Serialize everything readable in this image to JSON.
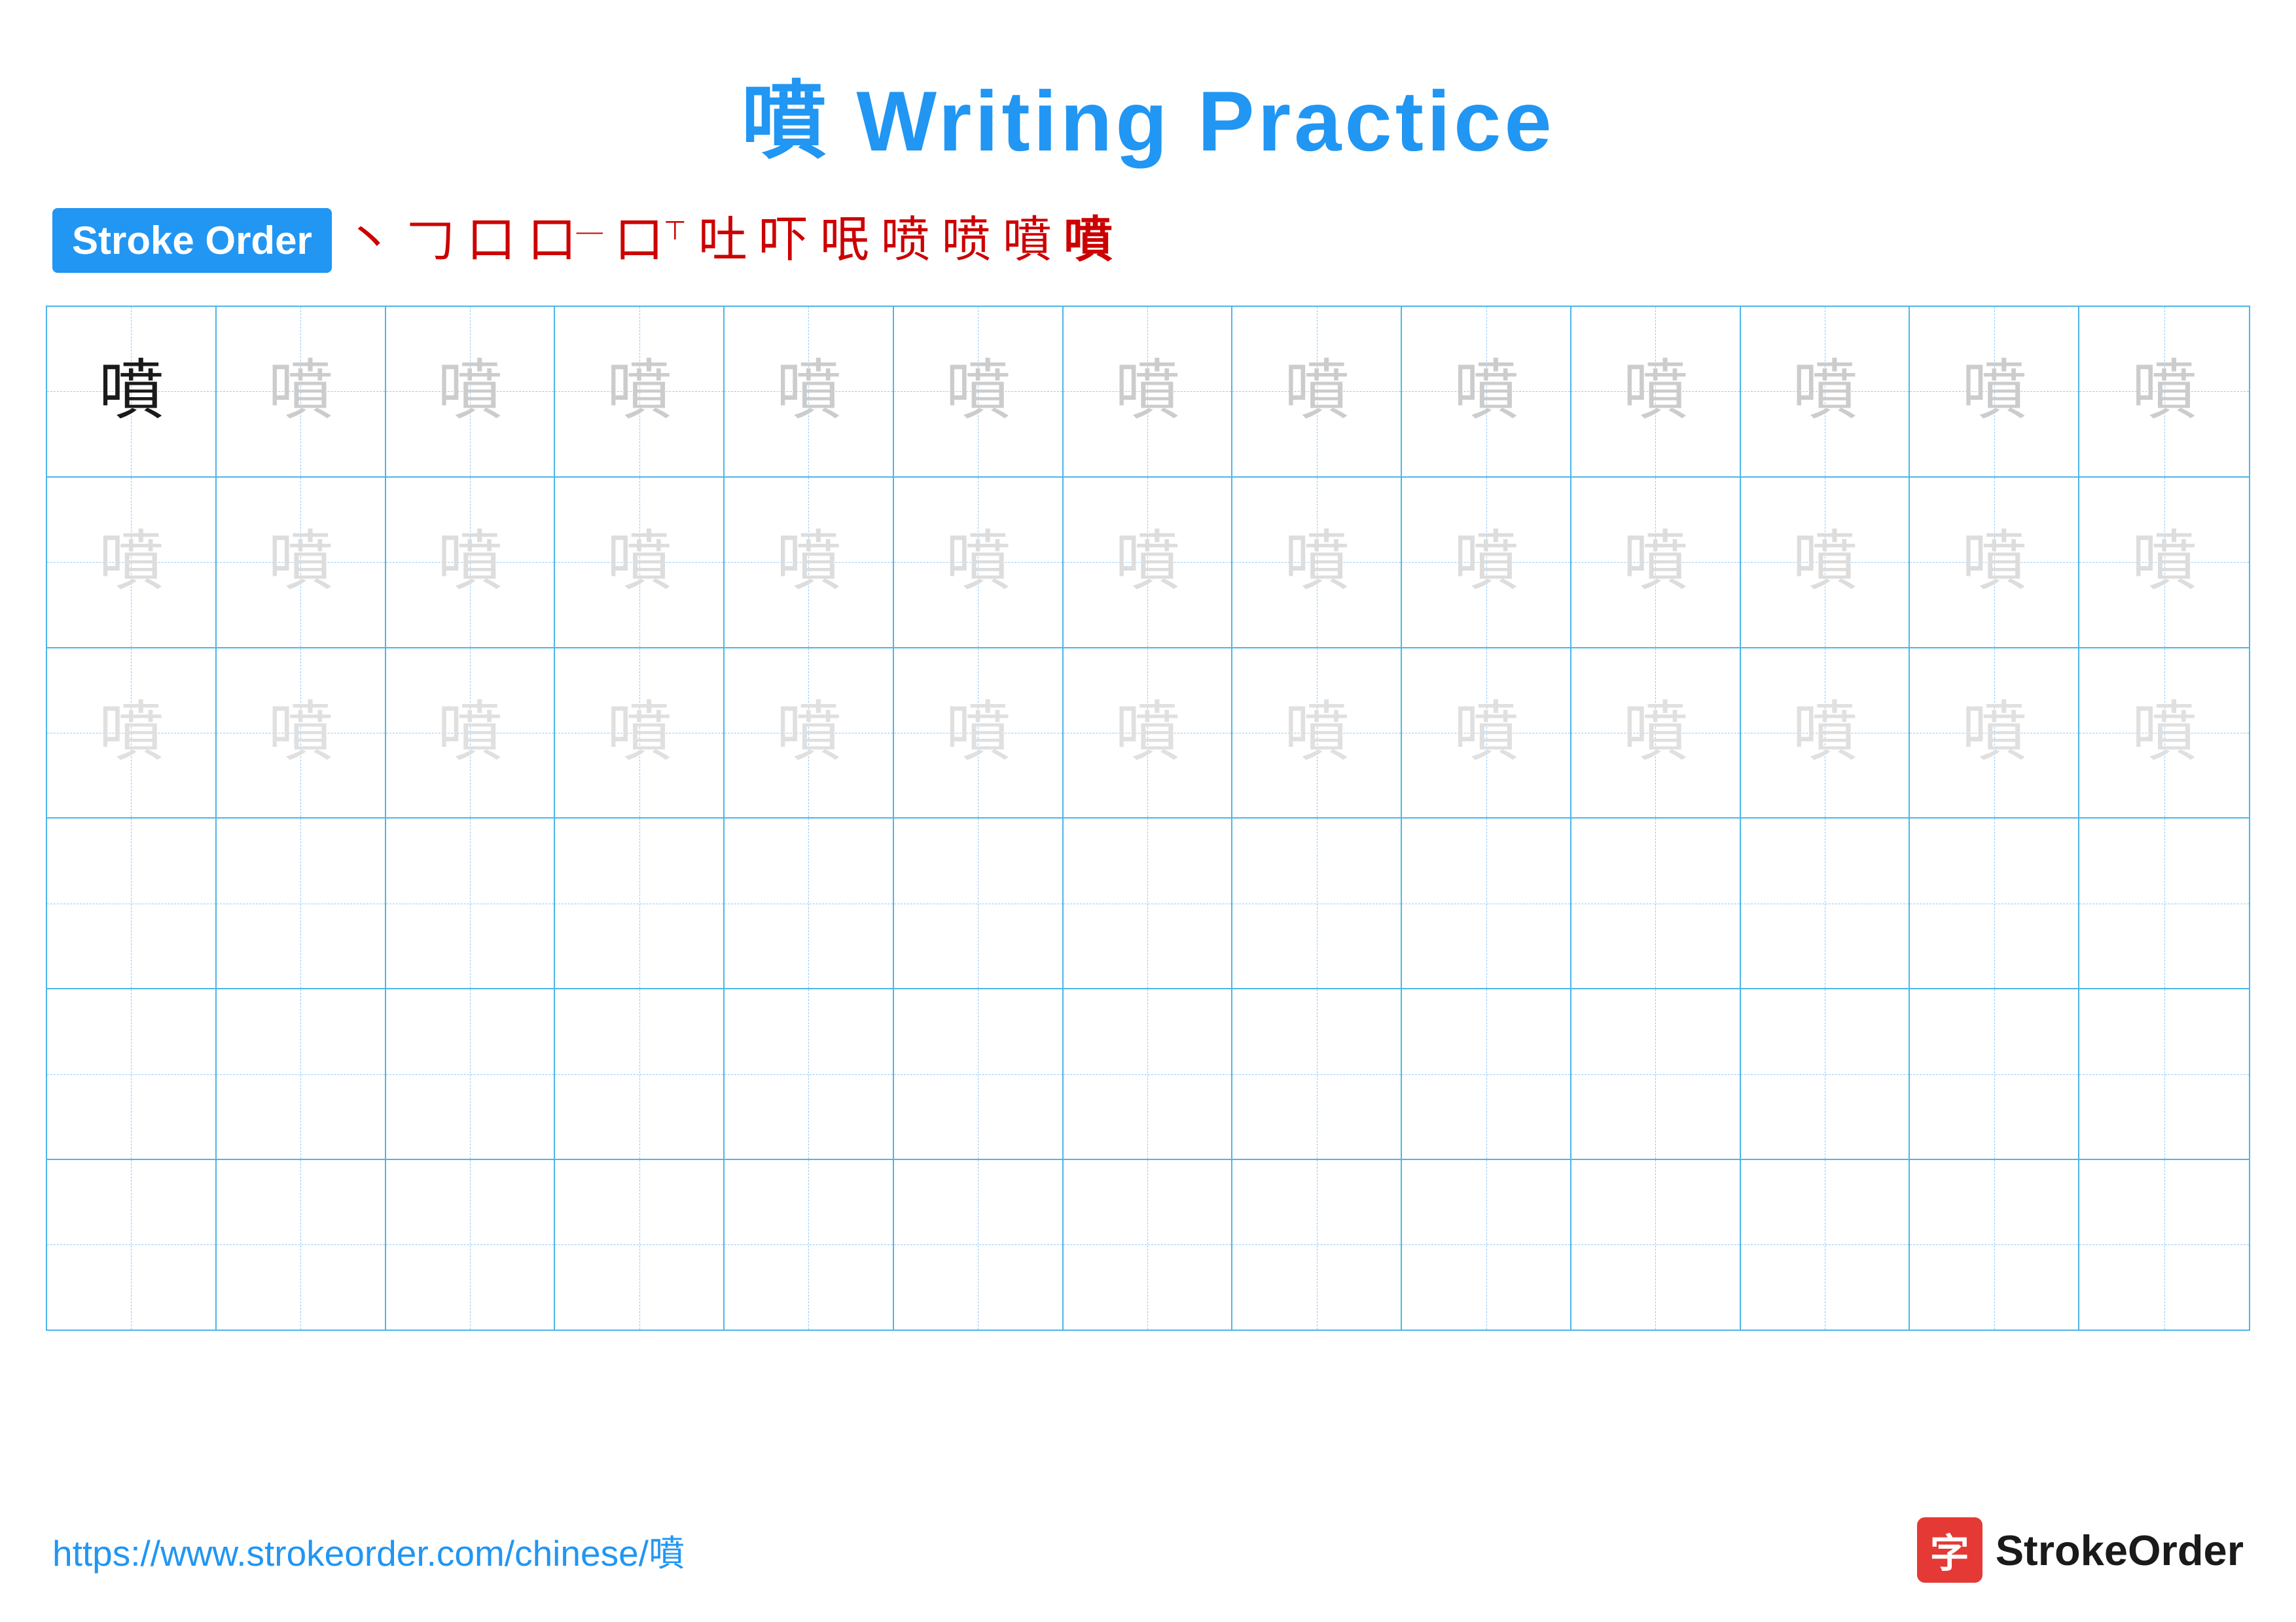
{
  "title": {
    "char": "噴",
    "suffix": " Writing Practice",
    "color": "#2196F3"
  },
  "stroke_order": {
    "badge_label": "Stroke Order",
    "strokes": [
      "丶",
      "𠃌",
      "口",
      "口⁻",
      "口⊤",
      "吐",
      "吓",
      "呡",
      "呡",
      "喷",
      "噴",
      "噴"
    ]
  },
  "grid": {
    "char": "噴",
    "rows": 6,
    "cols": 13,
    "filled_rows": 3,
    "row1_first_dark": true,
    "practice_char": "噴"
  },
  "footer": {
    "url": "https://www.strokeorder.com/chinese/噴",
    "logo_text": "StrokeOrder",
    "logo_symbol": "字"
  }
}
